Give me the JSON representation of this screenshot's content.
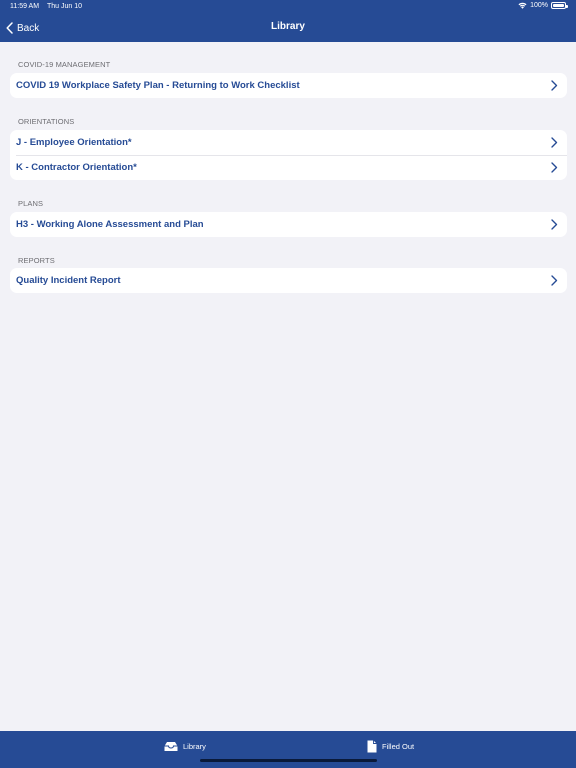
{
  "status_bar": {
    "time": "11:59 AM",
    "date": "Thu Jun 10",
    "battery_text": "100%",
    "battery_level": 1.0
  },
  "nav": {
    "back_label": "Back",
    "title": "Library"
  },
  "sections": [
    {
      "header": "COVID-19 MANAGEMENT",
      "items": [
        "COVID 19 Workplace Safety Plan - Returning to Work Checklist"
      ]
    },
    {
      "header": "ORIENTATIONS",
      "items": [
        "J - Employee Orientation*",
        "K - Contractor Orientation*"
      ]
    },
    {
      "header": "PLANS",
      "items": [
        "H3 - Working Alone Assessment and Plan"
      ]
    },
    {
      "header": "REPORTS",
      "items": [
        "Quality Incident Report"
      ]
    }
  ],
  "tab_bar": {
    "tabs": [
      {
        "label": "Library",
        "icon": "tray-icon"
      },
      {
        "label": "Filled Out",
        "icon": "document-icon"
      }
    ]
  },
  "colors": {
    "brand_blue": "#264b95",
    "background": "#f2f2f7",
    "row_background": "#ffffff",
    "section_header_text": "#6d6d72"
  }
}
